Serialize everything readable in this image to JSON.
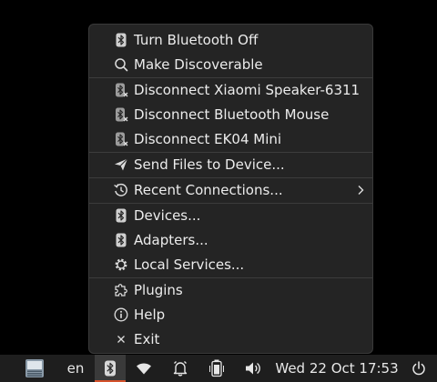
{
  "menu": {
    "items": [
      {
        "label": "Turn Bluetooth Off",
        "icon": "bluetooth-icon"
      },
      {
        "label": "Make Discoverable",
        "icon": "search-icon"
      },
      {
        "label": "Disconnect Xiaomi Speaker-6311",
        "icon": "bluetooth-disconnect-icon"
      },
      {
        "label": "Disconnect Bluetooth Mouse",
        "icon": "bluetooth-disconnect-icon"
      },
      {
        "label": "Disconnect EK04 Mini",
        "icon": "bluetooth-disconnect-icon"
      },
      {
        "label": "Send Files to Device...",
        "icon": "send-icon"
      },
      {
        "label": "Recent Connections...",
        "icon": "history-icon",
        "submenu": true
      },
      {
        "label": "Devices...",
        "icon": "bluetooth-icon"
      },
      {
        "label": "Adapters...",
        "icon": "bluetooth-icon"
      },
      {
        "label": "Local Services...",
        "icon": "gear-icon"
      },
      {
        "label": "Plugins",
        "icon": "puzzle-icon"
      },
      {
        "label": "Help",
        "icon": "info-icon"
      },
      {
        "label": "Exit",
        "icon": "close-icon"
      }
    ]
  },
  "panel": {
    "language": "en",
    "clock": "Wed 22 Oct 17:53",
    "accent_color": "#d4522b",
    "icons": [
      "app-launcher-icon",
      "bluetooth-icon",
      "wifi-icon",
      "notification-bell-icon",
      "battery-icon",
      "volume-icon",
      "power-icon"
    ]
  }
}
